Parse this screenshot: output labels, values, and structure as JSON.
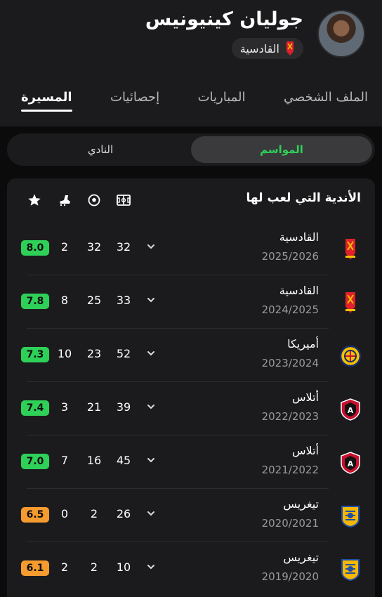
{
  "player": {
    "name": "جوليان كينيونيس",
    "club": "القادسية"
  },
  "tabs": [
    {
      "label": "الملف الشخصي",
      "active": false
    },
    {
      "label": "المباريات",
      "active": false
    },
    {
      "label": "إحصائيات",
      "active": false
    },
    {
      "label": "المسيرة",
      "active": true
    }
  ],
  "toggle": {
    "seasons_label": "المواسم",
    "club_label": "النادي",
    "active": "seasons"
  },
  "career": {
    "title": "الأندية التي لعب لها",
    "columns": [
      "appearances-icon",
      "goals-icon",
      "assists-icon",
      "rating-star-icon"
    ],
    "rows": [
      {
        "club": "القادسية",
        "season": "2025/2026",
        "crest": "qadsiah",
        "apps": "32",
        "goals": "32",
        "assists": "2",
        "rating": "8.0",
        "rating_color": "#2fd058"
      },
      {
        "club": "القادسية",
        "season": "2024/2025",
        "crest": "qadsiah",
        "apps": "33",
        "goals": "25",
        "assists": "8",
        "rating": "7.8",
        "rating_color": "#2fd058"
      },
      {
        "club": "أميريكا",
        "season": "2023/2024",
        "crest": "america",
        "apps": "52",
        "goals": "23",
        "assists": "10",
        "rating": "7.3",
        "rating_color": "#2fd058"
      },
      {
        "club": "أتلاس",
        "season": "2022/2023",
        "crest": "atlas",
        "apps": "39",
        "goals": "21",
        "assists": "3",
        "rating": "7.4",
        "rating_color": "#2fd058"
      },
      {
        "club": "أتلاس",
        "season": "2021/2022",
        "crest": "atlas",
        "apps": "45",
        "goals": "16",
        "assists": "7",
        "rating": "7.0",
        "rating_color": "#2fd058"
      },
      {
        "club": "تيغريس",
        "season": "2020/2021",
        "crest": "tigres",
        "apps": "26",
        "goals": "2",
        "assists": "0",
        "rating": "6.5",
        "rating_color": "#f59b2f"
      },
      {
        "club": "تيغريس",
        "season": "2019/2020",
        "crest": "tigres",
        "apps": "10",
        "goals": "2",
        "assists": "2",
        "rating": "6.1",
        "rating_color": "#f59b2f"
      }
    ]
  }
}
